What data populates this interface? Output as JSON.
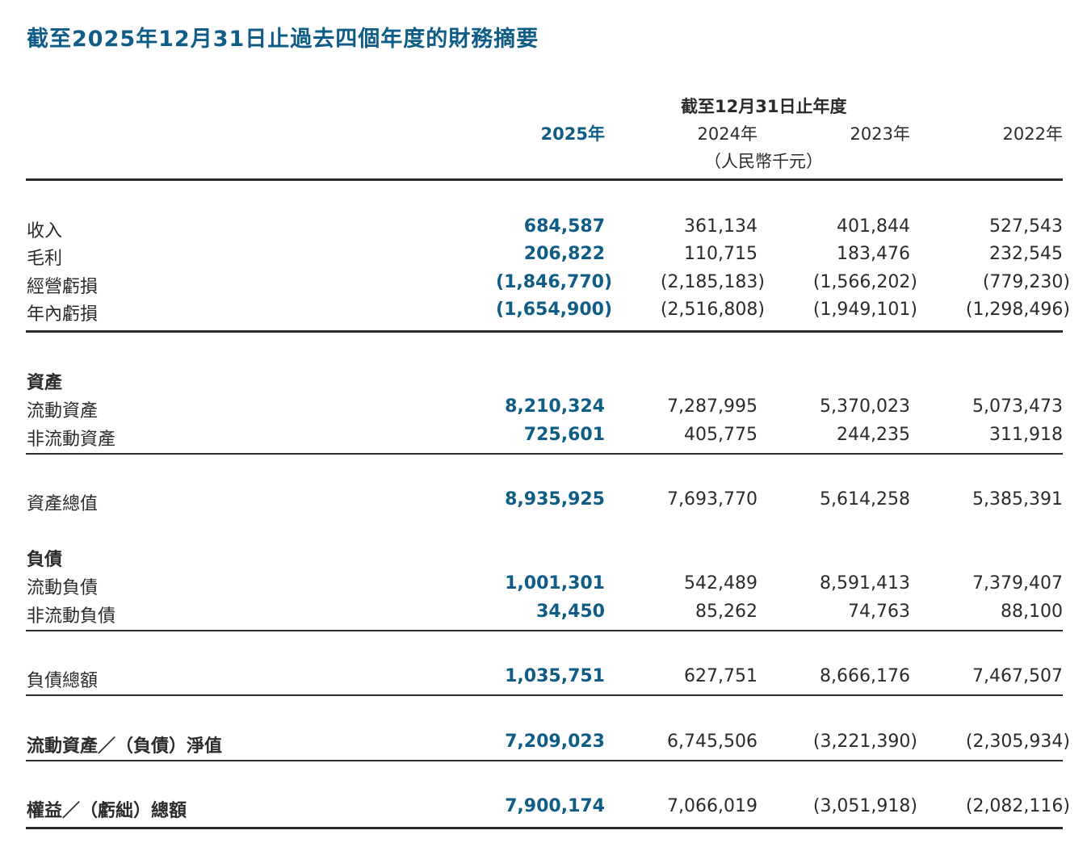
{
  "title": "截至2025年12月31日止過去四個年度的財務摘要",
  "header": {
    "period": "截至12月31日止年度",
    "unit": "（人民幣千元）",
    "years": [
      "2025年",
      "2024年",
      "2023年",
      "2022年"
    ]
  },
  "sections": {
    "assets": "資產",
    "liabilities": "負債"
  },
  "rows": [
    {
      "label": "收入",
      "values": [
        "684,587",
        "361,134",
        "401,844",
        "527,543"
      ]
    },
    {
      "label": "毛利",
      "values": [
        "206,822",
        "110,715",
        "183,476",
        "232,545"
      ]
    },
    {
      "label": "經營虧損",
      "values": [
        "(1,846,770)",
        "(2,185,183)",
        "(1,566,202)",
        "(779,230)"
      ]
    },
    {
      "label": "年內虧損",
      "values": [
        "(1,654,900)",
        "(2,516,808)",
        "(1,949,101)",
        "(1,298,496)"
      ]
    },
    {
      "label": "流動資產",
      "values": [
        "8,210,324",
        "7,287,995",
        "5,370,023",
        "5,073,473"
      ]
    },
    {
      "label": "非流動資產",
      "values": [
        "725,601",
        "405,775",
        "244,235",
        "311,918"
      ]
    },
    {
      "label": "資產總值",
      "values": [
        "8,935,925",
        "7,693,770",
        "5,614,258",
        "5,385,391"
      ]
    },
    {
      "label": "流動負債",
      "values": [
        "1,001,301",
        "542,489",
        "8,591,413",
        "7,379,407"
      ]
    },
    {
      "label": "非流動負債",
      "values": [
        "34,450",
        "85,262",
        "74,763",
        "88,100"
      ]
    },
    {
      "label": "負債總額",
      "values": [
        "1,035,751",
        "627,751",
        "8,666,176",
        "7,467,507"
      ]
    },
    {
      "label": "流動資產／（負債）淨值",
      "values": [
        "7,209,023",
        "6,745,506",
        "(3,221,390)",
        "(2,305,934)"
      ]
    },
    {
      "label": "權益／（虧絀）總額",
      "values": [
        "7,900,174",
        "7,066,019",
        "(3,051,918)",
        "(2,082,116)"
      ]
    }
  ]
}
